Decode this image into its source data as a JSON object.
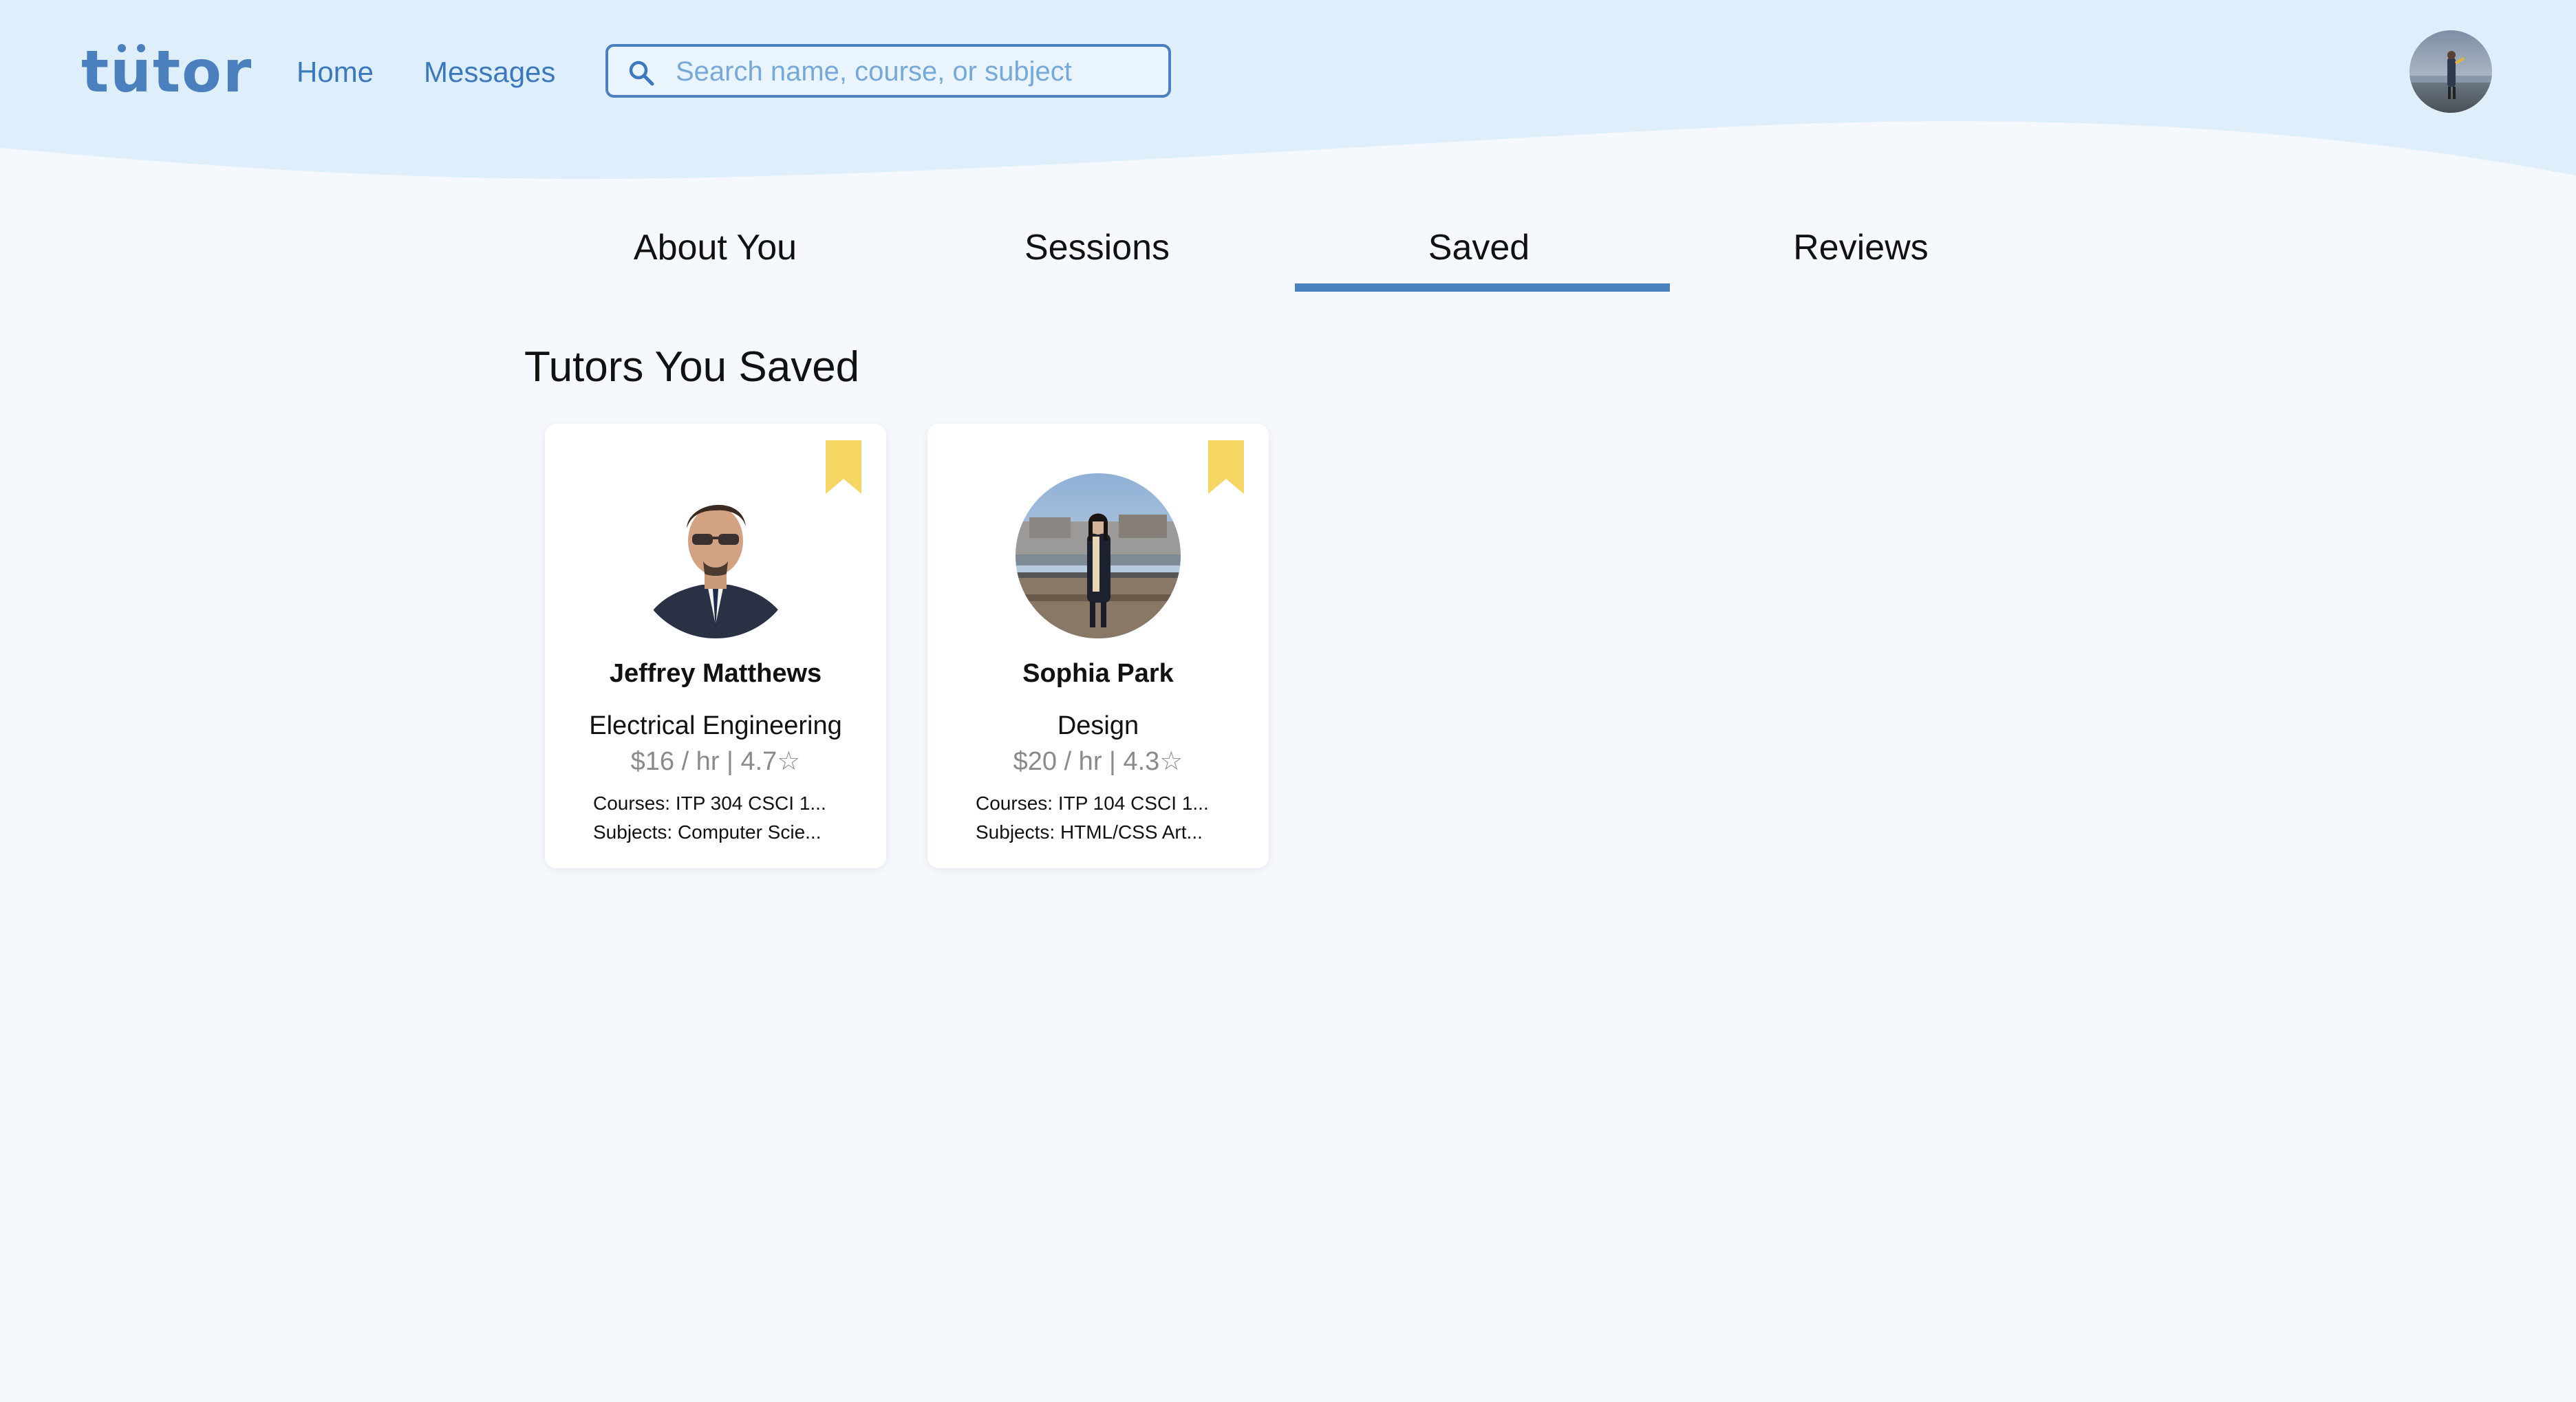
{
  "header": {
    "logo": "tütor",
    "nav": [
      {
        "label": "Home"
      },
      {
        "label": "Messages"
      }
    ],
    "search": {
      "placeholder": "Search name, course, or subject",
      "value": ""
    }
  },
  "tabs": [
    {
      "label": "About You",
      "active": false
    },
    {
      "label": "Sessions",
      "active": false
    },
    {
      "label": "Saved",
      "active": true
    },
    {
      "label": "Reviews",
      "active": false
    }
  ],
  "saved": {
    "title": "Tutors You Saved",
    "tutors": [
      {
        "name": "Jeffrey Matthews",
        "major": "Electrical Engineering",
        "rate": "$16 / hr | 4.7",
        "courses": "Courses: ITP 304 CSCI 1...",
        "subjects": "Subjects: Computer Scie..."
      },
      {
        "name": "Sophia Park",
        "major": "Design",
        "rate": "$20 / hr | 4.3",
        "courses": "Courses: ITP 104 CSCI 1...",
        "subjects": "Subjects: HTML/CSS Art..."
      }
    ]
  },
  "colors": {
    "brand": "#4a80bd",
    "header_bg": "#deeefb",
    "page_bg": "#f5f9fd",
    "bookmark": "#f5d663"
  },
  "icons": [
    "search-icon",
    "bookmark-icon",
    "star-icon"
  ]
}
